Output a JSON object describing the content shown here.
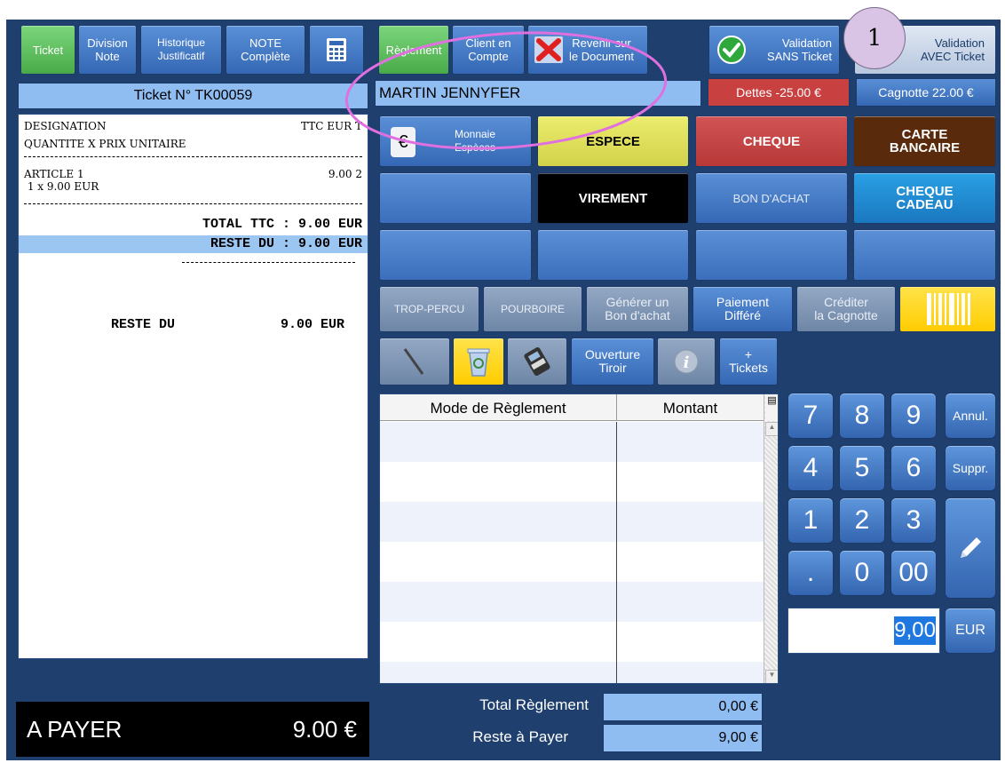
{
  "toolbar": {
    "ticket": "Ticket",
    "division_note": [
      "Division",
      "Note"
    ],
    "historique": [
      "Historique",
      "Justificatif"
    ],
    "note_complete": [
      "NOTE",
      "Complète"
    ],
    "calculator_icon": "calculator-icon",
    "reglement": "Règlement",
    "client_compte": [
      "Client en",
      "Compte"
    ],
    "revenir": [
      "Revenir sur",
      "le Document"
    ],
    "validation_sans": [
      "Validation",
      "SANS Ticket"
    ],
    "validation_avec": [
      "Validation",
      "AVEC Ticket"
    ],
    "badge": "1"
  },
  "header": {
    "ticket_no": "Ticket N° TK00059",
    "client": "MARTIN  JENNYFER",
    "dettes": "Dettes -25.00 €",
    "cagnotte": "Cagnotte 22.00 €"
  },
  "ticket": {
    "designation": "DESIGNATION",
    "ttc": "TTC EUR T",
    "qte_prix": "QUANTITE X PRIX UNITAIRE",
    "sep": "------------------------------------------",
    "article": "ARTICLE 1",
    "article_price": "9.00 2",
    "article_qty": " 1 x 9.00 EUR",
    "total_ttc": "TOTAL TTC : 9.00 EUR",
    "reste_du_line": "RESTE DU : 9.00 EUR",
    "sep_short": "-------------------------",
    "reste_du_label": "RESTE DU",
    "reste_du_value": "9.00 EUR"
  },
  "payment": {
    "monnaie": [
      "Monnaie",
      "Espèces"
    ],
    "euro_symbol": "€",
    "espece": "ESPECE",
    "cheque": "CHEQUE",
    "carte": [
      "CARTE",
      "BANCAIRE"
    ],
    "virement": "VIREMENT",
    "bon_achat": "BON D'ACHAT",
    "cheque_cadeau": [
      "CHEQUE",
      "CADEAU"
    ],
    "trop_percu": "TROP-PERCU",
    "pourboire": "POURBOIRE",
    "generer": [
      "Générer un",
      "Bon d'achat"
    ],
    "paiement": [
      "Paiement",
      "Différé"
    ],
    "crediter": [
      "Créditer",
      "la Cagnotte"
    ],
    "ouverture": [
      "Ouverture",
      "Tiroir"
    ],
    "tickets": [
      "+",
      "Tickets"
    ]
  },
  "table": {
    "col1": "Mode de Règlement",
    "col2": "Montant"
  },
  "keypad": {
    "k7": "7",
    "k8": "8",
    "k9": "9",
    "annul": "Annul.",
    "k4": "4",
    "k5": "5",
    "k6": "6",
    "suppr": "Suppr.",
    "k1": "1",
    "k2": "2",
    "k3": "3",
    "dot": ".",
    "k0": "0",
    "k00": "00",
    "input_value": "9,00",
    "eur": "EUR"
  },
  "footer": {
    "a_payer": "A PAYER",
    "a_payer_value": "9.00 €",
    "total_reglement": "Total Règlement",
    "total_reglement_value": "0,00 €",
    "reste_payer": "Reste à Payer",
    "reste_payer_value": "9,00 €"
  },
  "colors": {
    "bg": "#1f3f6e",
    "espece": "#e4e35a",
    "cheque": "#c94848",
    "carte": "#5a2a0c",
    "virement": "#000000",
    "cheque_cadeau": "#1f8fd6",
    "highlight": "#ffd400",
    "annotation": "#e070e0"
  }
}
